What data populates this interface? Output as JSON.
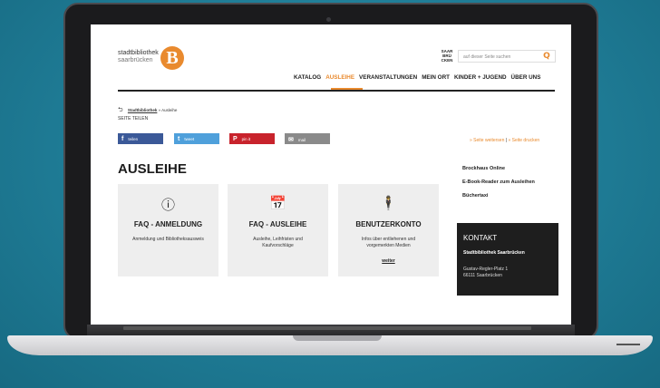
{
  "logo": {
    "line1": "stadtbibliothek",
    "line2": "saarbrücken",
    "letter": "B"
  },
  "saar_logo": "SAAR BRÜ CKEN",
  "search": {
    "placeholder": "auf dieser Seite suchen"
  },
  "nav": [
    "KATALOG",
    "AUSLEIHE",
    "VERANSTALTUNGEN",
    "MEIN ORT",
    "KINDER + JUGEND",
    "ÜBER UNS"
  ],
  "nav_active_index": 1,
  "breadcrumb": {
    "link": "Stadtbibliothek",
    "sep": "»",
    "current": "Ausleihe"
  },
  "share": {
    "title": "SEITE TEILEN",
    "buttons": [
      {
        "icon": "f",
        "label": "teilen",
        "color": "#3b5998"
      },
      {
        "icon": "t",
        "label": "tweet",
        "color": "#4fa0db"
      },
      {
        "icon": "P",
        "label": "pin it",
        "color": "#c8232c"
      },
      {
        "icon": "✉",
        "label": "mail",
        "color": "#8a8a8a"
      }
    ]
  },
  "page_actions": {
    "forward": "» Seite weitersen",
    "print": "» Seite drucken"
  },
  "title": "AUSLEIHE",
  "cards": [
    {
      "icon": "ⓘ",
      "title": "FAQ - ANMELDUNG",
      "desc": "Anmeldung und Bibliotheksausweis",
      "link": ""
    },
    {
      "icon": "📅",
      "title": "FAQ - AUSLEIHE",
      "desc": "Ausleihe, Leihfristen und Kaufvorschläge",
      "link": ""
    },
    {
      "icon": "🕴",
      "title": "BENUTZERKONTO",
      "desc": "Infos über entliehenen und vorgemerkten Medien",
      "link": "weiter"
    }
  ],
  "sidebar": [
    "Brockhaus Online",
    "E-Book-Reader zum Ausleihen",
    "Büchertaxi"
  ],
  "kontakt": {
    "heading": "KONTAKT",
    "name": "Stadtbibliothek Saarbrücken",
    "street": "Gustav-Regler-Platz 1",
    "city": "66111 Saarbrücken"
  },
  "colors": {
    "accent": "#e98a2e",
    "background": "#1f7c96"
  }
}
